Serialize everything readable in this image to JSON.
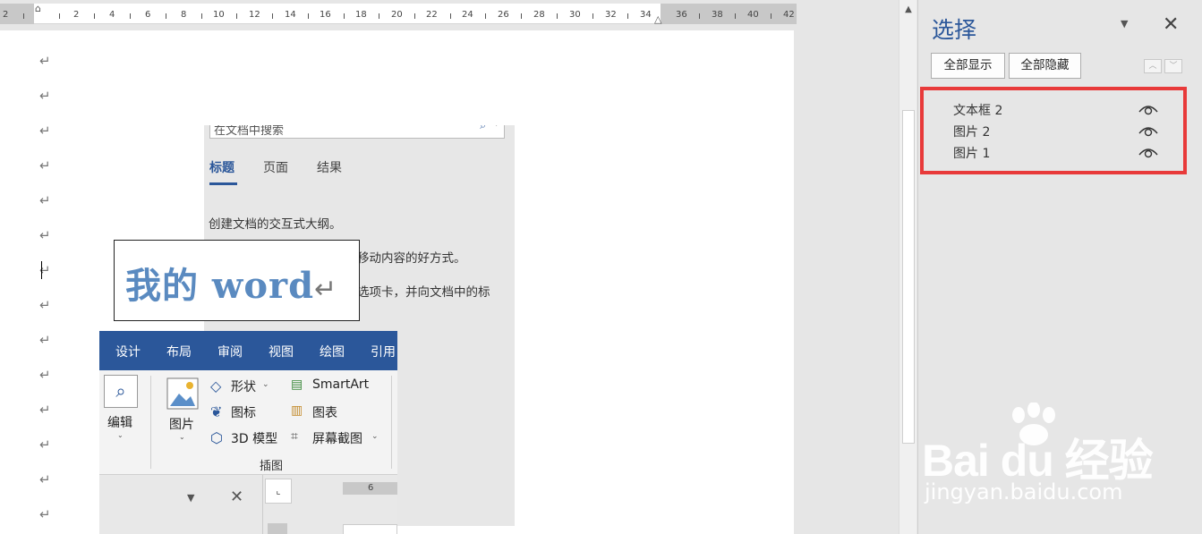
{
  "ruler": {
    "ticks": [
      "2",
      "2",
      "4",
      "6",
      "8",
      "10",
      "12",
      "14",
      "16",
      "18",
      "20",
      "22",
      "24",
      "26",
      "28",
      "30",
      "32",
      "34",
      "36",
      "38",
      "40",
      "42"
    ]
  },
  "document": {
    "paragraph_mark": "↵",
    "nav_pane": {
      "search_placeholder": "在文档中搜索",
      "tabs": [
        "标题",
        "页面",
        "结果"
      ],
      "lines": [
        "创建文档的交互式大纲。",
        "移动内容的好方式。",
        "选项卡，并向文档中的标"
      ]
    },
    "wordart": {
      "text": "我的 word",
      "mark": "↵"
    },
    "ribbon": {
      "tabs": [
        "设计",
        "布局",
        "审阅",
        "视图",
        "绘图",
        "引用"
      ],
      "edit_label": "编辑",
      "picture_label": "图片",
      "shapes_label": "形状",
      "icons_label": "图标",
      "model3d_label": "3D 模型",
      "smartart_label": "SmartArt",
      "chart_label": "图表",
      "screenshot_label": "屏幕截图",
      "group_label": "插图",
      "bottom_ruler": "6"
    }
  },
  "selection_pane": {
    "title": "选择",
    "show_all": "全部显示",
    "hide_all": "全部隐藏",
    "objects": [
      {
        "label": "文本框 2",
        "icon": "eye-icon"
      },
      {
        "label": "图片 2",
        "icon": "eye-icon"
      },
      {
        "label": "图片 1",
        "icon": "eye-icon"
      }
    ],
    "highlight_color": "#e83a3a",
    "title_color": "#2b579a"
  },
  "watermark": {
    "brand": "Bai du 经验",
    "url": "jingyan.baidu.com"
  }
}
